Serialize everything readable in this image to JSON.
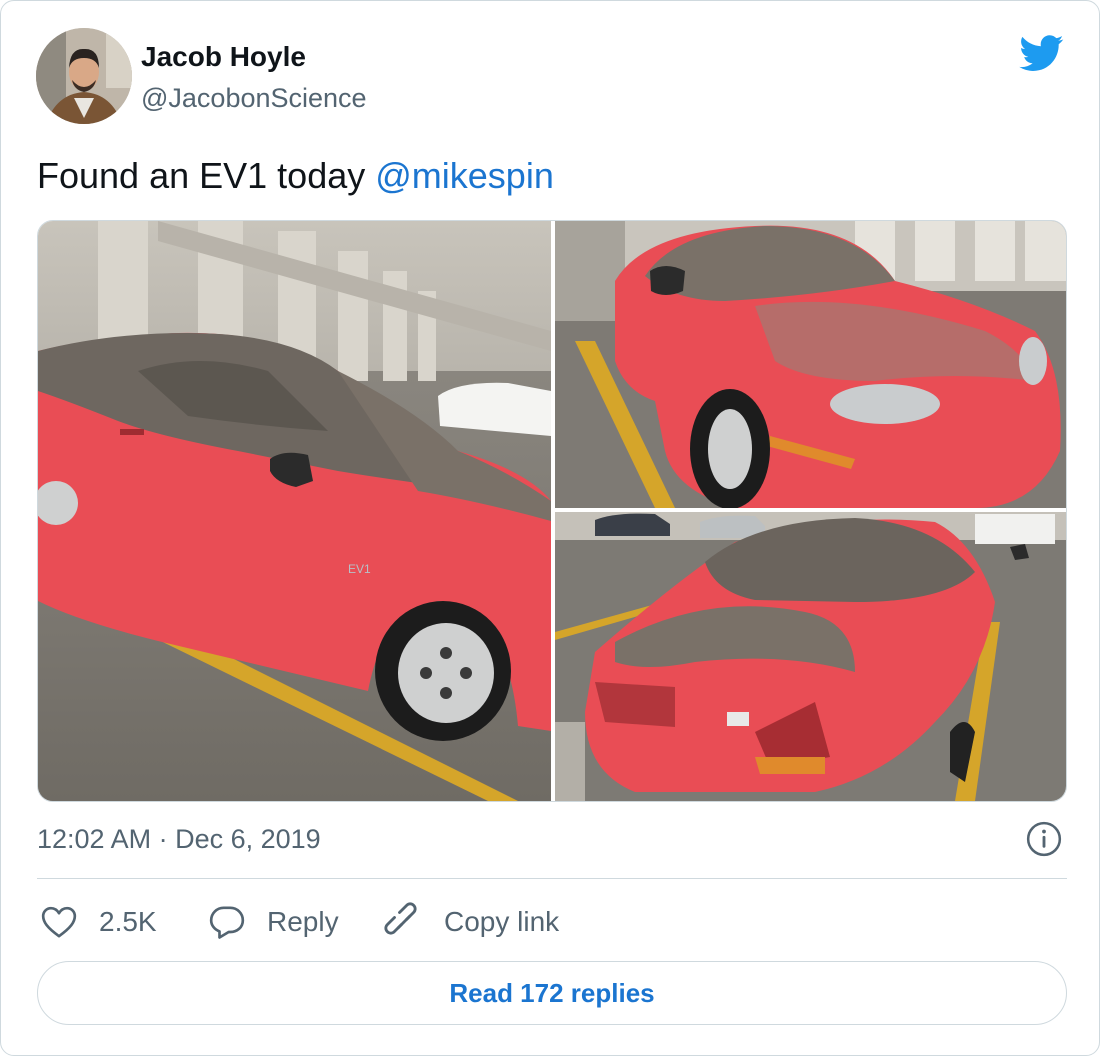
{
  "author": {
    "name": "Jacob Hoyle",
    "handle": "@JacobonScience"
  },
  "tweet": {
    "text": "Found an EV1 today ",
    "mention": "@mikespin",
    "timestamp": "12:02 AM · Dec 6, 2019"
  },
  "actions": {
    "like_count": "2.5K",
    "reply_label": "Reply",
    "copy_link_label": "Copy link"
  },
  "read_replies_label": "Read 172 replies",
  "colors": {
    "brand_blue": "#1d9bf0",
    "link_blue": "#1b75d0",
    "muted": "#536471",
    "border": "#cfd9de"
  },
  "icons": [
    "twitter-bird-icon",
    "info-icon",
    "heart-icon",
    "reply-bubble-icon",
    "link-chain-icon"
  ]
}
